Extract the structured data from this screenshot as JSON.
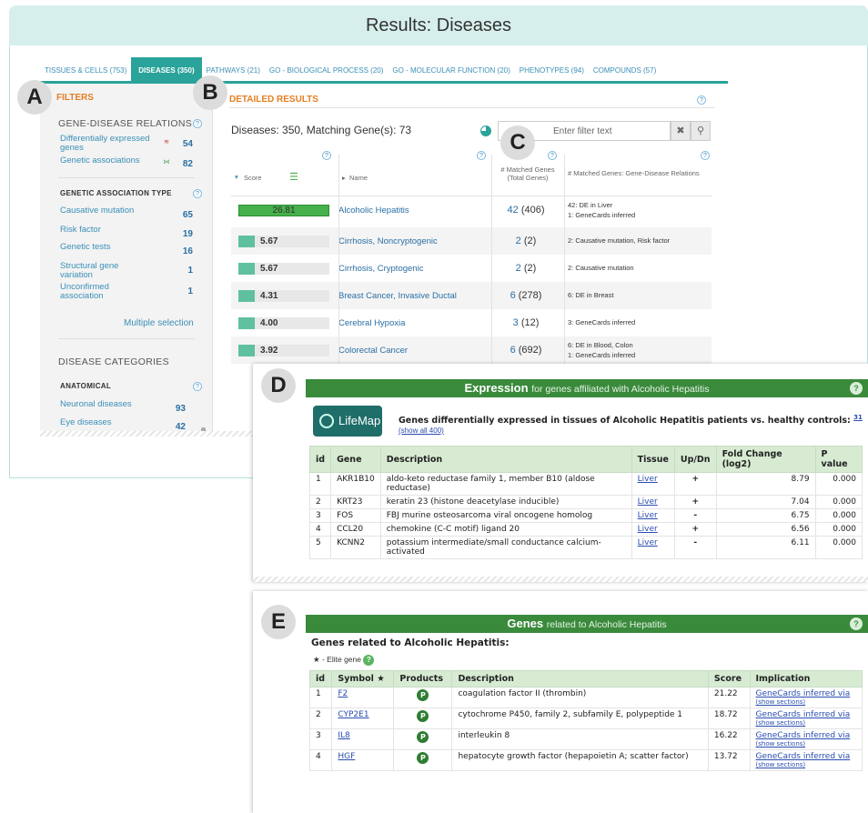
{
  "page_title": "Results: Diseases",
  "callouts": [
    "A",
    "B",
    "C",
    "D",
    "E"
  ],
  "tabs": [
    {
      "label": "TISSUES & CELLS (753)",
      "active": false
    },
    {
      "label": "DISEASES (350)",
      "active": true
    },
    {
      "label": "PATHWAYS (21)",
      "active": false
    },
    {
      "label": "GO - BIOLOGICAL PROCESS (20)",
      "active": false
    },
    {
      "label": "GO - MOLECULAR FUNCTION (20)",
      "active": false
    },
    {
      "label": "PHENOTYPES (94)",
      "active": false
    },
    {
      "label": "COMPOUNDS (57)",
      "active": false
    }
  ],
  "filters": {
    "heading": "FILTERS",
    "gene_disease_relations": {
      "title": "GENE-DISEASE RELATIONS",
      "items": [
        {
          "label": "Differentially expressed genes",
          "count": "54"
        },
        {
          "label": "Genetic associations",
          "count": "82"
        }
      ]
    },
    "genetic_association_type": {
      "title": "GENETIC ASSOCIATION TYPE",
      "items": [
        {
          "label": "Causative mutation",
          "count": "65"
        },
        {
          "label": "Risk factor",
          "count": "19"
        },
        {
          "label": "Genetic tests",
          "count": "16"
        },
        {
          "label": "Structural gene variation",
          "count": "1"
        },
        {
          "label": "Unconfirmed association",
          "count": "1"
        }
      ],
      "multiple_selection": "Multiple selection"
    },
    "disease_categories": {
      "title": "DISEASE CATEGORIES",
      "subtitle": "ANATOMICAL",
      "items": [
        {
          "label": "Neuronal diseases",
          "count": "93"
        },
        {
          "label": "Eye diseases",
          "count": "42"
        }
      ]
    }
  },
  "detailed_results": {
    "heading": "DETAILED RESULTS",
    "summary": "Diseases: 350,  Matching Gene(s): 73",
    "search_placeholder": "Enter filter text",
    "columns": {
      "score": "Score",
      "name": "Name",
      "matched": "# Matched Genes (Total Genes)",
      "relations": "# Matched Genes: Gene-Disease Relations"
    },
    "rows": [
      {
        "score": "26.81",
        "fraction": 1.0,
        "name": "Alcoholic Hepatitis",
        "matched": "42",
        "total": "(406)",
        "relations": [
          "42: DE in Liver",
          "1: GeneCards inferred"
        ]
      },
      {
        "score": "5.67",
        "fraction": 0.2,
        "name": "Cirrhosis, Noncryptogenic",
        "matched": "2",
        "total": "(2)",
        "relations": [
          "2: Causative mutation, Risk factor"
        ]
      },
      {
        "score": "5.67",
        "fraction": 0.2,
        "name": "Cirrhosis, Cryptogenic",
        "matched": "2",
        "total": "(2)",
        "relations": [
          "2: Causative mutation"
        ]
      },
      {
        "score": "4.31",
        "fraction": 0.2,
        "name": "Breast Cancer, Invasive Ductal",
        "matched": "6",
        "total": "(278)",
        "relations": [
          "6: DE in Breast"
        ]
      },
      {
        "score": "4.00",
        "fraction": 0.2,
        "name": "Cerebral Hypoxia",
        "matched": "3",
        "total": "(12)",
        "relations": [
          "3: GeneCards inferred"
        ]
      },
      {
        "score": "3.92",
        "fraction": 0.2,
        "name": "Colorectal Cancer",
        "matched": "6",
        "total": "(692)",
        "relations": [
          "6: DE in Blood, Colon",
          "1: GeneCards inferred"
        ]
      }
    ]
  },
  "expression_panel": {
    "bar_title": "Expression",
    "bar_subtitle": "for genes affiliated with Alcoholic Hepatitis",
    "logo_text": "LifeMap",
    "description": "Genes differentially expressed in tissues of Alcoholic Hepatitis patients vs. healthy controls:",
    "description_ref": "31",
    "show_all": "(show all 400)",
    "headers": [
      "id",
      "Gene",
      "Description",
      "Tissue",
      "Up/Dn",
      "Fold Change (log2)",
      "P value"
    ],
    "rows": [
      [
        "1",
        "AKR1B10",
        "aldo-keto reductase family 1, member B10 (aldose reductase)",
        "Liver",
        "+",
        "8.79",
        "0.000"
      ],
      [
        "2",
        "KRT23",
        "keratin 23 (histone deacetylase inducible)",
        "Liver",
        "+",
        "7.04",
        "0.000"
      ],
      [
        "3",
        "FOS",
        "FBJ murine osteosarcoma viral oncogene homolog",
        "Liver",
        "-",
        "6.75",
        "0.000"
      ],
      [
        "4",
        "CCL20",
        "chemokine (C-C motif) ligand 20",
        "Liver",
        "+",
        "6.56",
        "0.000"
      ],
      [
        "5",
        "KCNN2",
        "potassium intermediate/small conductance calcium-activated",
        "Liver",
        "-",
        "6.11",
        "0.000"
      ]
    ]
  },
  "genes_panel": {
    "bar_title": "Genes",
    "bar_subtitle": "related to Alcoholic Hepatitis",
    "title": "Genes related to Alcoholic Hepatitis:",
    "elite_note": "★ - Elite gene",
    "headers": [
      "id",
      "Symbol ★",
      "Products",
      "Description",
      "Score",
      "Implication"
    ],
    "show_sections": "(show sections)",
    "product_badge": "P",
    "rows": [
      [
        "1",
        "F2",
        "coagulation factor II (thrombin)",
        "21.22",
        "GeneCards inferred via"
      ],
      [
        "2",
        "CYP2E1",
        "cytochrome P450, family 2, subfamily E, polypeptide 1",
        "18.72",
        "GeneCards inferred via"
      ],
      [
        "3",
        "IL8",
        "interleukin 8",
        "16.22",
        "GeneCards inferred via"
      ],
      [
        "4",
        "HGF",
        "hepatocyte growth factor (hepapoietin A; scatter factor)",
        "13.72",
        "GeneCards inferred via"
      ]
    ]
  }
}
